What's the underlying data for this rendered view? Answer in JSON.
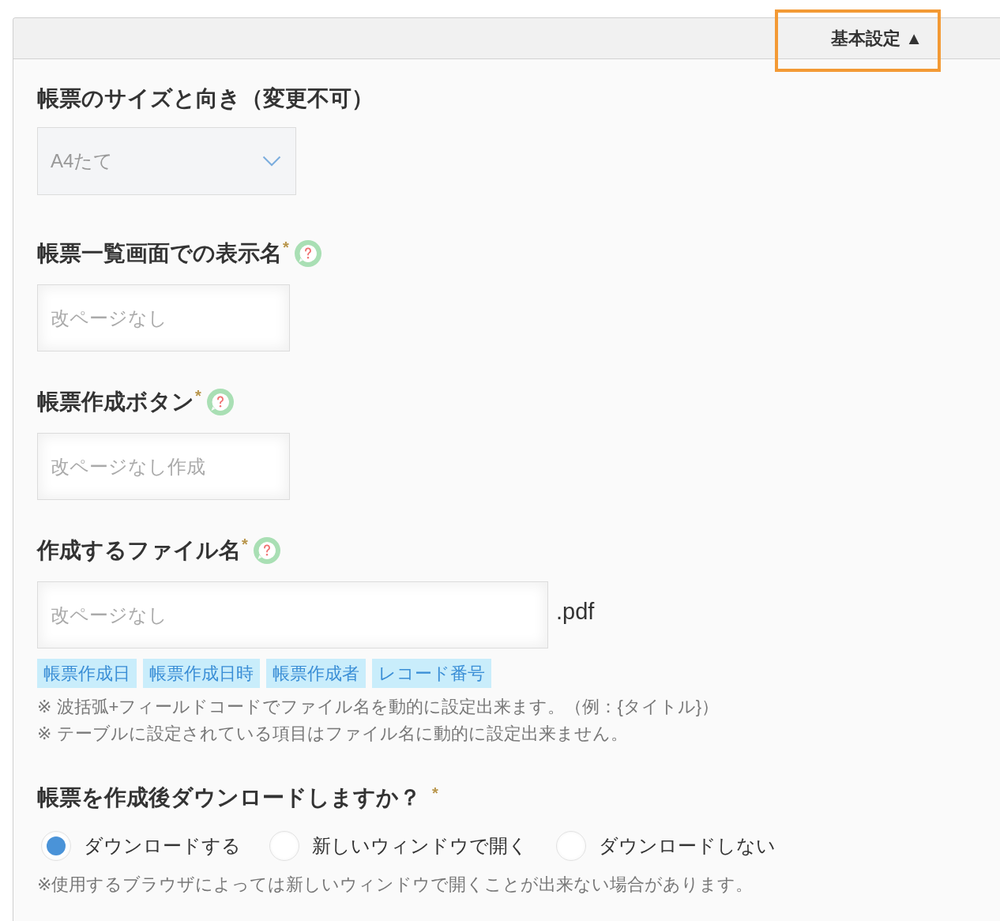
{
  "panel_header": {
    "toggle": {
      "label": "基本設定",
      "arrow": "▲",
      "highlighted": true
    }
  },
  "sections": [
    {
      "kind": "select",
      "title": "帳票のサイズと向き（変更不可）",
      "value": "A4たて",
      "disabled": true
    },
    {
      "kind": "text",
      "title": "帳票一覧画面での表示名",
      "required_mark": "*",
      "help": true,
      "placeholder": "改ページなし"
    },
    {
      "kind": "text",
      "title": "帳票作成ボタン",
      "required_mark": "*",
      "help": true,
      "placeholder": "改ページなし作成"
    },
    {
      "kind": "filename",
      "title": "作成するファイル名",
      "required_mark": "*",
      "help": true,
      "placeholder": "改ページなし",
      "suffix": ".pdf",
      "tags": [
        "帳票作成日",
        "帳票作成日時",
        "帳票作成者",
        "レコード番号"
      ],
      "notes": [
        "※ 波括弧+フィールドコードでファイル名を動的に設定出来ます。（例：{タイトル}）",
        "※ テーブルに設定されている項目はファイル名に動的に設定出来ません。"
      ]
    },
    {
      "kind": "radio",
      "title": "帳票を作成後ダウンロードしますか？",
      "required_mark": "*",
      "options": [
        {
          "label": "ダウンロードする",
          "selected": true
        },
        {
          "label": "新しいウィンドウで開く",
          "selected": false
        },
        {
          "label": "ダウンロードしない",
          "selected": false
        }
      ],
      "note": "※使用するブラウザによっては新しいウィンドウで開くことが出来ない場合があります。"
    }
  ]
}
